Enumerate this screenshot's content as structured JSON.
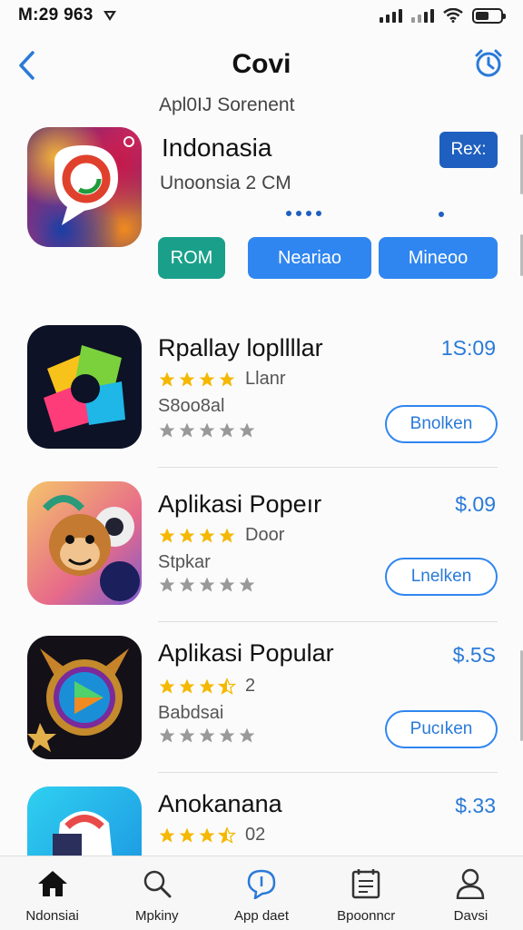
{
  "status": {
    "time": "M:29 963"
  },
  "nav": {
    "title": "Covi"
  },
  "section_label": "Apl0IJ Sorenent",
  "featured": {
    "name": "Indonasia",
    "subtitle": "Unoonsia 2 CM",
    "badge": "Rex:",
    "buttons": [
      "ROM",
      "Neariao",
      "Mineoo"
    ]
  },
  "apps": [
    {
      "name": "Rpallay lopllllar",
      "price": "1S:09",
      "rating_meta": "Llanr",
      "category": "S8oo8al",
      "button": "Bnolken",
      "gold_stars": 4
    },
    {
      "name": "Aplikasi Popeır",
      "price": "$.09",
      "rating_meta": "Door",
      "category": "Stpkar",
      "button": "Lnelken",
      "gold_stars": 4
    },
    {
      "name": "Aplikasi Popular",
      "price": "$.5S",
      "rating_meta": "2",
      "category": "Babdsai",
      "button": "Pucıken",
      "gold_stars": 3.5
    },
    {
      "name": "Anokanana",
      "price": "$.33",
      "rating_meta": "02",
      "category": "",
      "button": "",
      "gold_stars": 3.5
    }
  ],
  "tabs": [
    {
      "label": "Ndonsiai",
      "icon": "home-icon"
    },
    {
      "label": "Mpkiny",
      "icon": "search-icon"
    },
    {
      "label": "App daet",
      "icon": "apps-icon"
    },
    {
      "label": "Bpoonncr",
      "icon": "list-icon"
    },
    {
      "label": "Davsi",
      "icon": "profile-icon"
    }
  ],
  "colors": {
    "accent": "#2f86f0",
    "badge": "#1f5fbf",
    "green": "#1aa08a",
    "star": "#f5b800"
  }
}
